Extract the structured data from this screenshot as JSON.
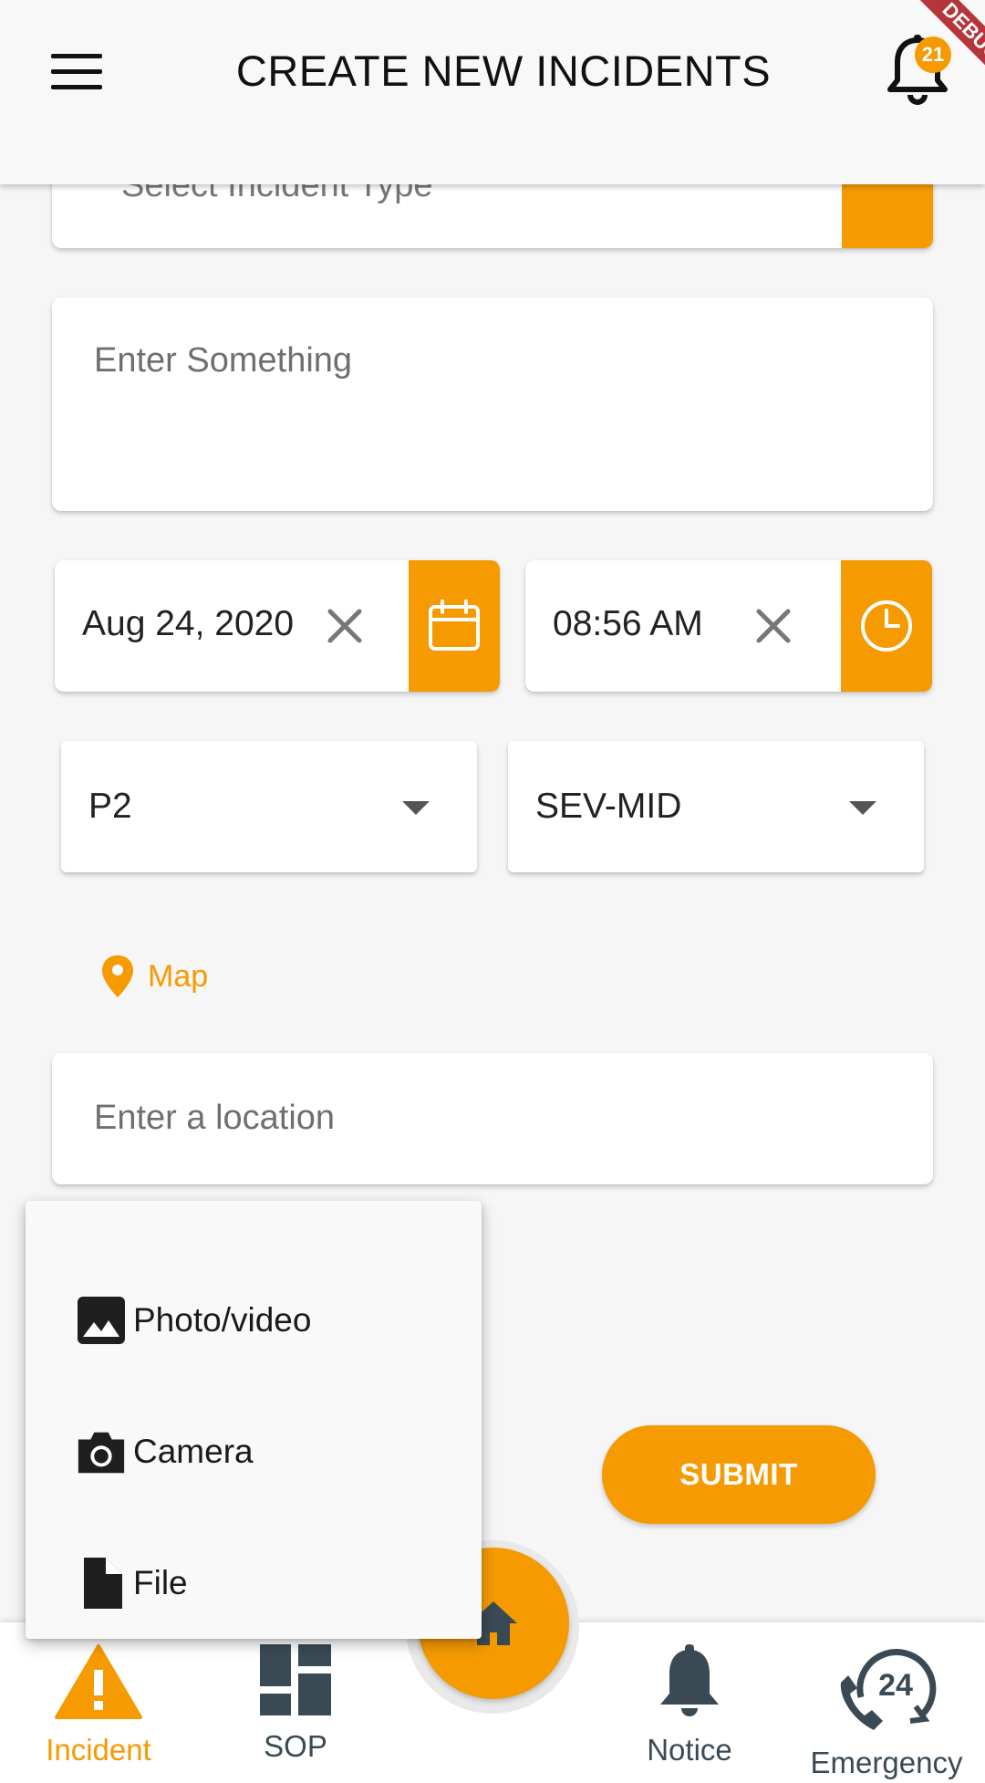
{
  "app_bar": {
    "title": "CREATE NEW INCIDENTS",
    "notification_count": "21",
    "debug_ribbon": "DEBUG"
  },
  "form": {
    "incident_type_placeholder": "Select Incident Type",
    "description_placeholder": "Enter Something",
    "date_value": "Aug 24, 2020",
    "time_value": "08:56 AM",
    "priority_selected": "P2",
    "severity_selected": "SEV-MID",
    "map_label": "Map",
    "location_placeholder": "Enter a location",
    "submit_label": "SUBMIT"
  },
  "attachment_menu": {
    "items": [
      {
        "label": "Photo/video",
        "icon": "image-icon"
      },
      {
        "label": "Camera",
        "icon": "camera-icon"
      },
      {
        "label": "File",
        "icon": "file-icon"
      }
    ]
  },
  "bottom_nav": {
    "items": [
      {
        "label": "Incident",
        "icon": "warning-icon",
        "active": true
      },
      {
        "label": "SOP",
        "icon": "dashboard-icon"
      },
      {
        "label": "Notice",
        "icon": "bell-icon"
      },
      {
        "label": "Emergency",
        "icon": "phone-24-icon"
      }
    ],
    "center_icon": "home-icon"
  },
  "colors": {
    "accent": "#f59a00",
    "nav_icon": "#3a4a55",
    "background": "#f6f6f6"
  }
}
